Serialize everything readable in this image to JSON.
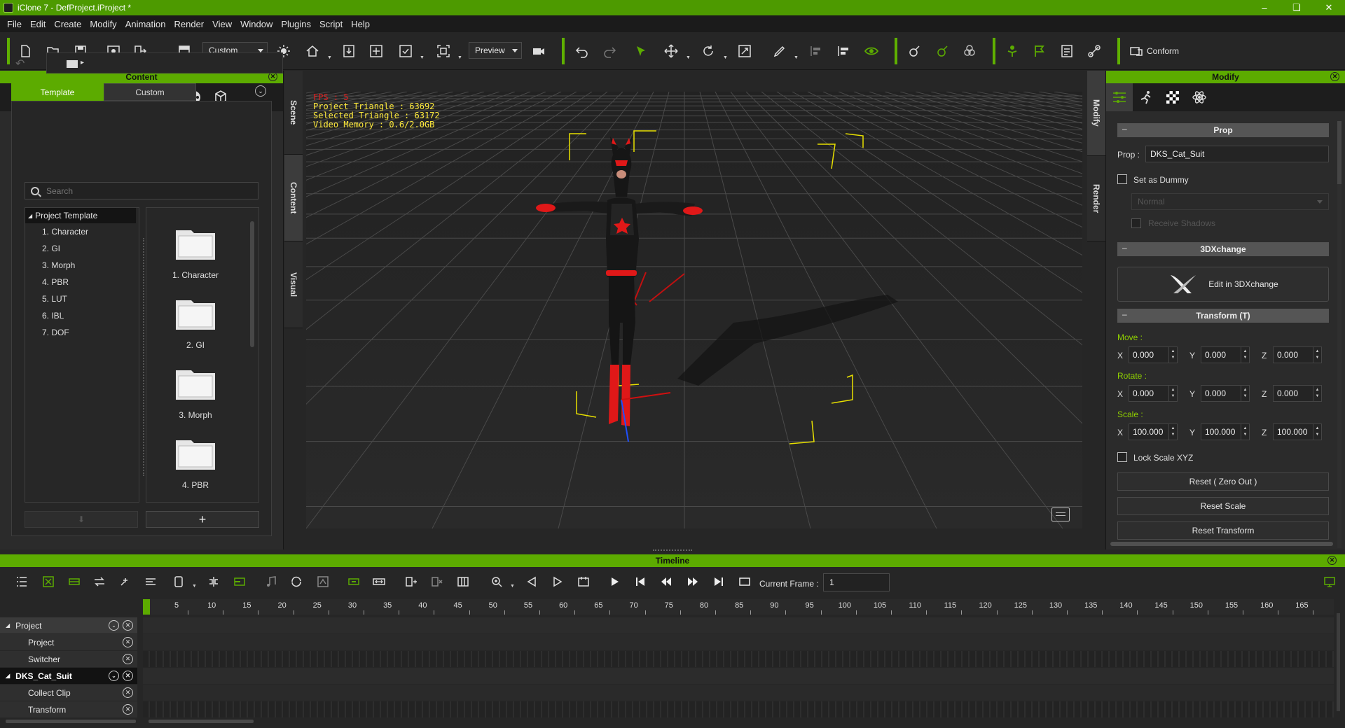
{
  "window": {
    "title": "iClone 7 - DefProject.iProject *"
  },
  "menu": [
    "File",
    "Edit",
    "Create",
    "Modify",
    "Animation",
    "Render",
    "View",
    "Window",
    "Plugins",
    "Script",
    "Help"
  ],
  "toolbar": {
    "project_mode": "Custom",
    "render_mode": "Preview",
    "conform_label": "Conform",
    "icons": [
      "new-file-icon",
      "open-folder-icon",
      "save-icon",
      "project-settings-icon",
      "export-icon",
      "layout-icon",
      "sun-icon",
      "home-icon",
      "import-icon",
      "fit-view-icon",
      "camera-frame-icon",
      "zoom-extent-icon",
      "video-camera-icon",
      "undo-icon",
      "redo-icon",
      "select-arrow-icon",
      "move-icon",
      "rotate-icon",
      "scale-icon",
      "paint-icon",
      "align-icon",
      "align-right-icon",
      "eye-icon",
      "attach-icon",
      "pick-parent-icon",
      "group-icon",
      "person-pin-icon",
      "flag-icon",
      "checklist-icon",
      "link-icon",
      "conform-icon"
    ]
  },
  "content_panel": {
    "title": "Content",
    "tabs": {
      "template": "Template",
      "custom": "Custom"
    },
    "search_placeholder": "Search",
    "tree": {
      "root": "Project Template",
      "items": [
        "1. Character",
        "2. GI",
        "3. Morph",
        "4. PBR",
        "5. LUT",
        "6. IBL",
        "7. DOF"
      ]
    },
    "grid": [
      "1. Character",
      "2. GI",
      "3. Morph",
      "4. PBR"
    ],
    "add_label": "+",
    "down_label": "⬇"
  },
  "left_side_tabs": [
    "Scene",
    "Content",
    "Visual"
  ],
  "right_side_tabs": [
    "Modify",
    "Render"
  ],
  "viewport": {
    "fps": "FPS : 5",
    "project_triangle": "Project Triangle : 63692",
    "selected_triangle": "Selected Triangle : 63172",
    "video_memory": "Video Memory : 0.6/2.0GB"
  },
  "modify_panel": {
    "title": "Modify",
    "prop_section": "Prop",
    "prop_label": "Prop :",
    "prop_name": "DKS_Cat_Suit",
    "set_as_dummy": "Set as Dummy",
    "normal_option": "Normal",
    "receive_shadows": "Receive Shadows",
    "xchange_section": "3DXchange",
    "edit_in_3dxchange": "Edit in 3DXchange",
    "transform_section": "Transform  (T)",
    "move_label": "Move :",
    "rotate_label": "Rotate :",
    "scale_label": "Scale :",
    "move": {
      "x": "0.000",
      "y": "0.000",
      "z": "0.000"
    },
    "rotate": {
      "x": "0.000",
      "y": "0.000",
      "z": "0.000"
    },
    "scale": {
      "x": "100.000",
      "y": "100.000",
      "z": "100.000"
    },
    "axis_x": "X",
    "axis_y": "Y",
    "axis_z": "Z",
    "lock_scale": "Lock Scale XYZ",
    "reset_zero": "Reset ( Zero Out )",
    "reset_scale": "Reset Scale",
    "reset_transform": "Reset Transform"
  },
  "timeline": {
    "title": "Timeline",
    "current_frame_label": "Current Frame :",
    "current_frame": "1",
    "ticks": [
      "5",
      "10",
      "15",
      "20",
      "25",
      "30",
      "35",
      "40",
      "45",
      "50",
      "55",
      "60",
      "65",
      "70",
      "75",
      "80",
      "85",
      "90",
      "95",
      "100",
      "105",
      "110",
      "115",
      "120",
      "125",
      "130",
      "135",
      "140",
      "145",
      "150",
      "155",
      "160",
      "165"
    ],
    "tracks": [
      {
        "name": "Project",
        "type": "group"
      },
      {
        "name": "Project",
        "type": "sub"
      },
      {
        "name": "Switcher",
        "type": "sub"
      },
      {
        "name": "DKS_Cat_Suit",
        "type": "group-selected"
      },
      {
        "name": "Collect Clip",
        "type": "sub"
      },
      {
        "name": "Transform",
        "type": "sub"
      }
    ]
  },
  "colors": {
    "accent": "#5cab00",
    "title_bar": "#4d9a00"
  }
}
